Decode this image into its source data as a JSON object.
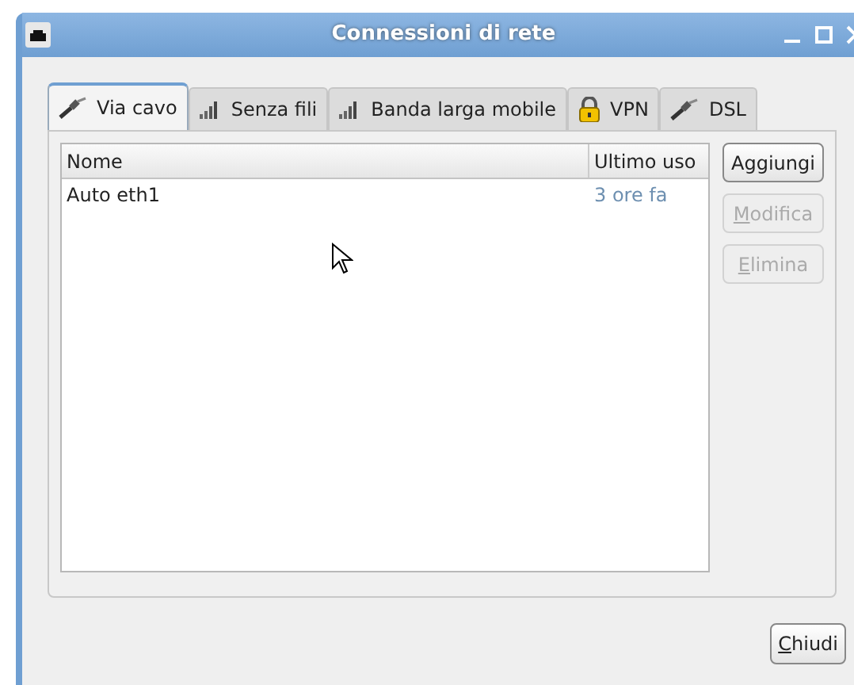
{
  "window": {
    "title": "Connessioni di rete"
  },
  "tabs": [
    {
      "label": "Via cavo",
      "kind": "cable",
      "selected": true
    },
    {
      "label": "Senza fili",
      "kind": "signal",
      "selected": false
    },
    {
      "label": "Banda larga mobile",
      "kind": "signal",
      "selected": false
    },
    {
      "label": "VPN",
      "kind": "lock",
      "selected": false
    },
    {
      "label": "DSL",
      "kind": "cable",
      "selected": false
    }
  ],
  "table": {
    "columns": [
      "Nome",
      "Ultimo uso"
    ],
    "rows": [
      {
        "name": "Auto eth1",
        "last_used": "3 ore fa"
      }
    ]
  },
  "side_buttons": [
    {
      "label": "Aggiungi",
      "disabled": false,
      "mnemonic": false
    },
    {
      "label": "Modifica",
      "disabled": true,
      "mnemonic": true
    },
    {
      "label": "Elimina",
      "disabled": true,
      "mnemonic": true
    }
  ],
  "close_button": {
    "label": "Chiudi",
    "mnemonic": true
  }
}
